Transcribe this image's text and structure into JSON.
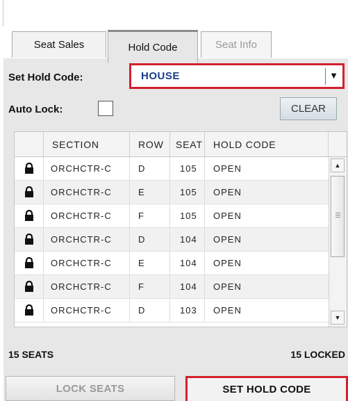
{
  "tabs": [
    {
      "label": "Seat Sales",
      "active": false
    },
    {
      "label": "Hold Code",
      "active": true
    },
    {
      "label": "Seat Info",
      "disabled": true
    }
  ],
  "hold_code": {
    "label": "Set Hold Code:",
    "value": "HOUSE"
  },
  "auto_lock": {
    "label": "Auto Lock:",
    "checked": false
  },
  "clear_button": "CLEAR",
  "table": {
    "columns": [
      "SECTION",
      "ROW",
      "SEAT",
      "HOLD CODE"
    ],
    "rows": [
      {
        "section": "ORCHCTR-C",
        "row": "D",
        "seat": "105",
        "hold": "OPEN"
      },
      {
        "section": "ORCHCTR-C",
        "row": "E",
        "seat": "105",
        "hold": "OPEN"
      },
      {
        "section": "ORCHCTR-C",
        "row": "F",
        "seat": "105",
        "hold": "OPEN"
      },
      {
        "section": "ORCHCTR-C",
        "row": "D",
        "seat": "104",
        "hold": "OPEN"
      },
      {
        "section": "ORCHCTR-C",
        "row": "E",
        "seat": "104",
        "hold": "OPEN"
      },
      {
        "section": "ORCHCTR-C",
        "row": "F",
        "seat": "104",
        "hold": "OPEN"
      },
      {
        "section": "ORCHCTR-C",
        "row": "D",
        "seat": "103",
        "hold": "OPEN"
      }
    ]
  },
  "footer": {
    "seat_count": "15 SEATS",
    "locked_count": "15 LOCKED",
    "lock_seats_button": "LOCK SEATS",
    "set_hold_code_button": "SET HOLD CODE"
  },
  "colors": {
    "highlight": "#d4202e",
    "hold_value": "#1a3a8a"
  },
  "icons": {
    "row": "padlock-icon",
    "dropdown": "triangle-down-icon"
  }
}
